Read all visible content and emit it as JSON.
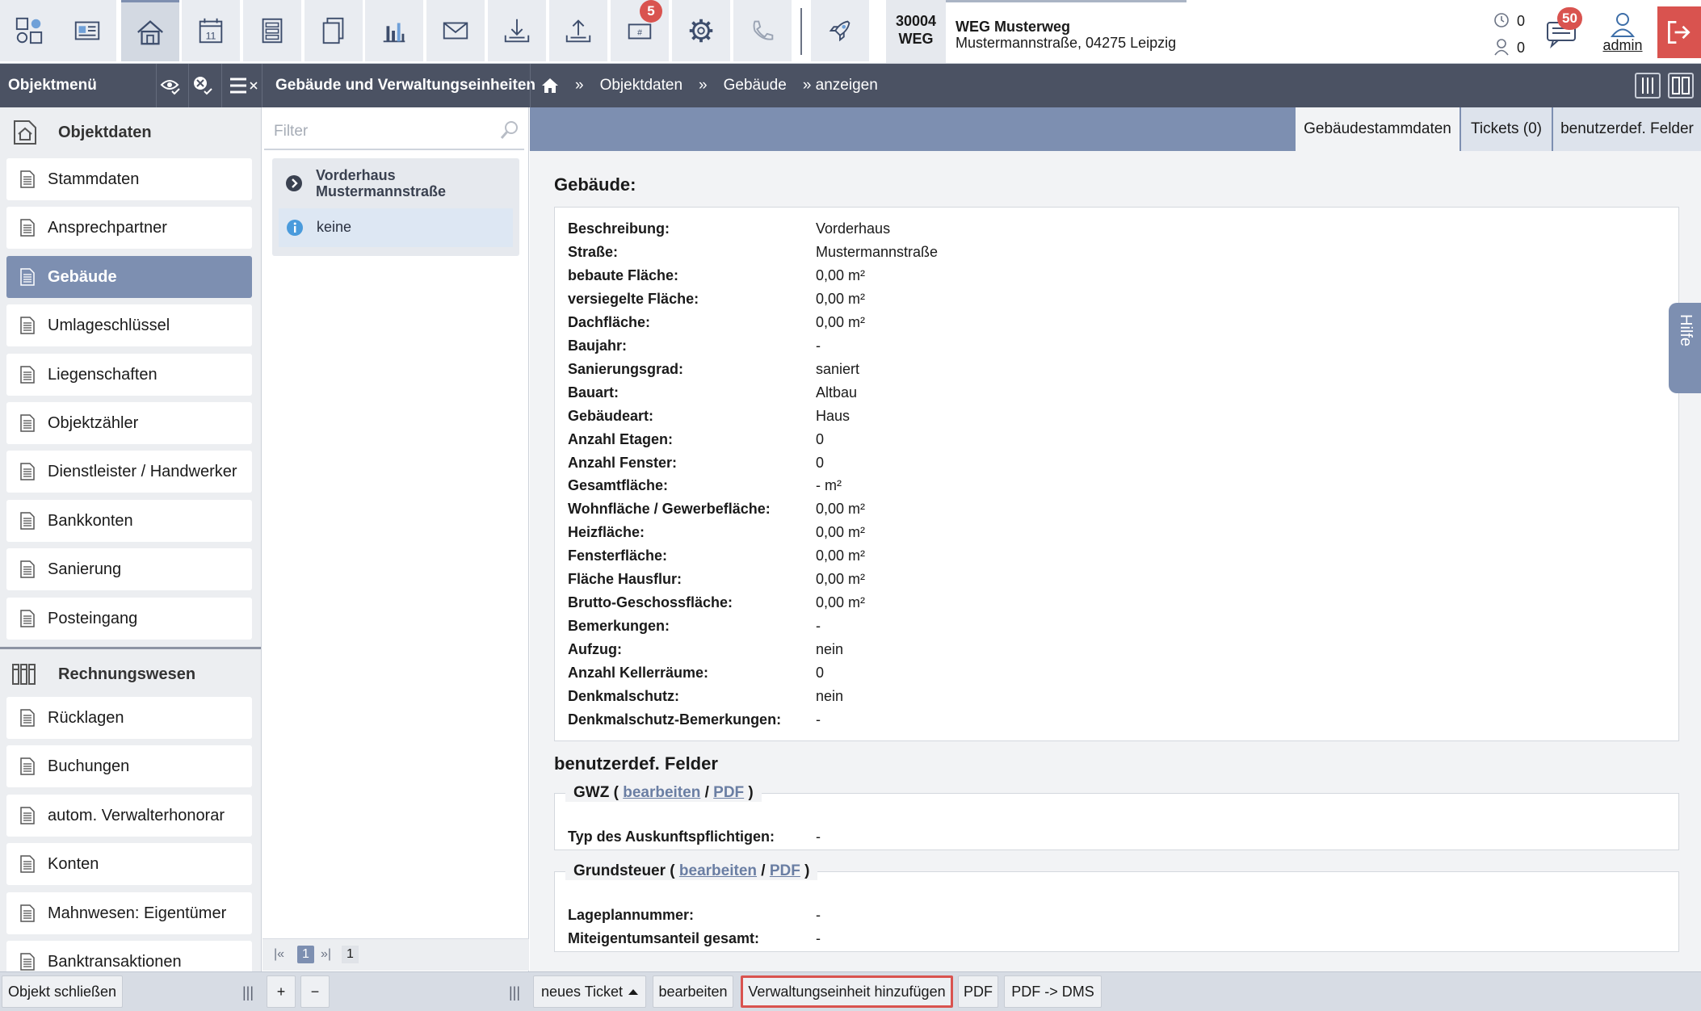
{
  "topbar": {
    "toolbar": [
      {
        "icon": "dashboard-icon"
      },
      {
        "icon": "contacts-card-icon"
      },
      {
        "icon": "home-icon"
      },
      {
        "icon": "calendar-icon",
        "text": "11"
      },
      {
        "icon": "form-icon"
      },
      {
        "icon": "documents-icon"
      },
      {
        "icon": "bar-chart-icon"
      },
      {
        "icon": "mail-icon"
      },
      {
        "icon": "download-tray-icon"
      },
      {
        "icon": "upload-tray-icon"
      },
      {
        "icon": "ticket-icon",
        "badge": "5"
      },
      {
        "icon": "gear-icon"
      },
      {
        "icon": "phone-icon"
      },
      {
        "icon": "rocket-icon"
      }
    ],
    "object_number": "30004",
    "object_type": "WEG",
    "object_title": "WEG Musterweg",
    "object_address": "Mustermannstraße, 04275 Leipzig",
    "counter_top": "0",
    "counter_bottom": "0",
    "messages_badge": "50",
    "user": "admin"
  },
  "darkbar": {
    "menu_title": "Objektmenü",
    "page_title": "Gebäude und Verwaltungseinheiten",
    "breadcrumb": [
      "»",
      "Objektdaten",
      "»",
      "Gebäude",
      "» anzeigen"
    ]
  },
  "sidebar": {
    "section1": "Objektdaten",
    "items1": [
      "Stammdaten",
      "Ansprechpartner",
      "Gebäude",
      "Umlageschlüssel",
      "Liegenschaften",
      "Objektzähler",
      "Dienstleister / Handwerker",
      "Bankkonten",
      "Sanierung",
      "Posteingang"
    ],
    "section2": "Rechnungswesen",
    "items2": [
      "Rücklagen",
      "Buchungen",
      "autom. Verwalterhonorar",
      "Konten",
      "Mahnwesen: Eigentümer",
      "Banktransaktionen"
    ]
  },
  "middle": {
    "filter_placeholder": "Filter",
    "tree_building": "Vorderhaus Mustermannstraße",
    "tree_child": "keine",
    "pager_first": "|«",
    "pager_current": "1",
    "pager_last": "»|",
    "pager_total": "1"
  },
  "tabs": [
    "Gebäudestammdaten",
    "Tickets (0)",
    "benutzerdef. Felder"
  ],
  "building": {
    "title": "Gebäude:",
    "fields": [
      {
        "k": "Beschreibung:",
        "v": "Vorderhaus"
      },
      {
        "k": "Straße:",
        "v": "Mustermannstraße"
      },
      {
        "k": "bebaute Fläche:",
        "v": "0,00 m²"
      },
      {
        "k": "versiegelte Fläche:",
        "v": "0,00 m²"
      },
      {
        "k": "Dachfläche:",
        "v": "0,00 m²"
      },
      {
        "k": "Baujahr:",
        "v": "-"
      },
      {
        "k": "Sanierungsgrad:",
        "v": "saniert"
      },
      {
        "k": "Bauart:",
        "v": "Altbau"
      },
      {
        "k": "Gebäudeart:",
        "v": "Haus"
      },
      {
        "k": "Anzahl Etagen:",
        "v": "0"
      },
      {
        "k": "Anzahl Fenster:",
        "v": "0"
      },
      {
        "k": "Gesamtfläche:",
        "v": "- m²"
      },
      {
        "k": "Wohnfläche / Gewerbefläche:",
        "v": "0,00 m²"
      },
      {
        "k": "Heizfläche:",
        "v": "0,00 m²"
      },
      {
        "k": "Fensterfläche:",
        "v": "0,00 m²"
      },
      {
        "k": "Fläche Hausflur:",
        "v": "0,00 m²"
      },
      {
        "k": "Brutto-Geschossfläche:",
        "v": "0,00 m²"
      },
      {
        "k": "Bemerkungen:",
        "v": "-"
      },
      {
        "k": "Aufzug:",
        "v": "nein"
      },
      {
        "k": "Anzahl Kellerräume:",
        "v": "0"
      },
      {
        "k": "Denkmalschutz:",
        "v": "nein"
      },
      {
        "k": "Denkmalschutz-Bemerkungen:",
        "v": "-"
      }
    ]
  },
  "custom": {
    "title": "benutzerdef. Felder",
    "edit_label": "bearbeiten",
    "pdf_label": "PDF",
    "groups": [
      {
        "name": "GWZ",
        "fields": [
          {
            "k": "Typ des Auskunftspflichtigen:",
            "v": "-"
          }
        ]
      },
      {
        "name": "Grundsteuer",
        "fields": [
          {
            "k": "Lageplannummer:",
            "v": "-"
          },
          {
            "k": "Miteigentumsanteil gesamt:",
            "v": "-"
          }
        ]
      }
    ]
  },
  "help_tab": "Hilfe",
  "bottombar": {
    "close_object": "Objekt schließen",
    "plus": "+",
    "minus": "−",
    "new_ticket": "neues Ticket",
    "edit": "bearbeiten",
    "add_unit": "Verwaltungseinheit hinzufügen",
    "pdf": "PDF",
    "pdf_dms": "PDF -> DMS"
  },
  "colors": {
    "accent": "#7d8fb1",
    "dark_bar": "#4b5263",
    "badge": "#d9534f",
    "logout": "#d9534f"
  }
}
